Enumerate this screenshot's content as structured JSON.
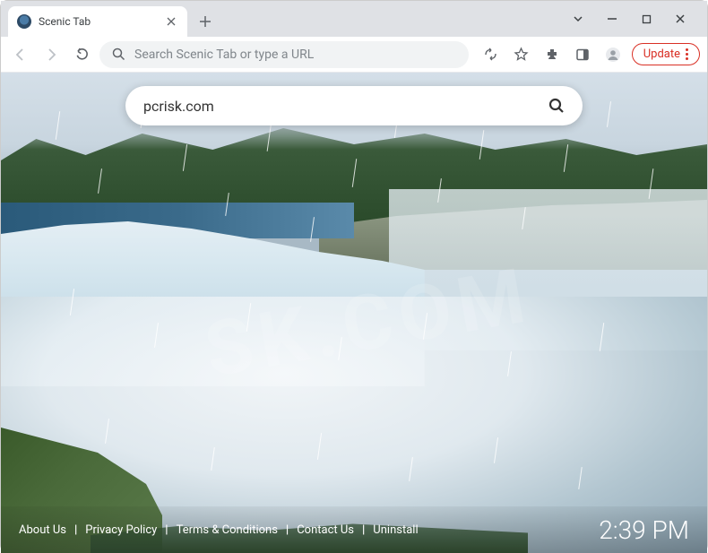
{
  "tab": {
    "title": "Scenic Tab"
  },
  "omnibox": {
    "placeholder": "Search Scenic Tab or type a URL"
  },
  "toolbar": {
    "update_label": "Update"
  },
  "search": {
    "value": "pcrisk.com"
  },
  "footer": {
    "links": [
      {
        "label": "About Us"
      },
      {
        "label": "Privacy Policy"
      },
      {
        "label": "Terms & Conditions"
      },
      {
        "label": "Contact Us"
      },
      {
        "label": "Uninstall"
      }
    ],
    "clock": "2:39 PM"
  },
  "watermark": "SK.COM"
}
